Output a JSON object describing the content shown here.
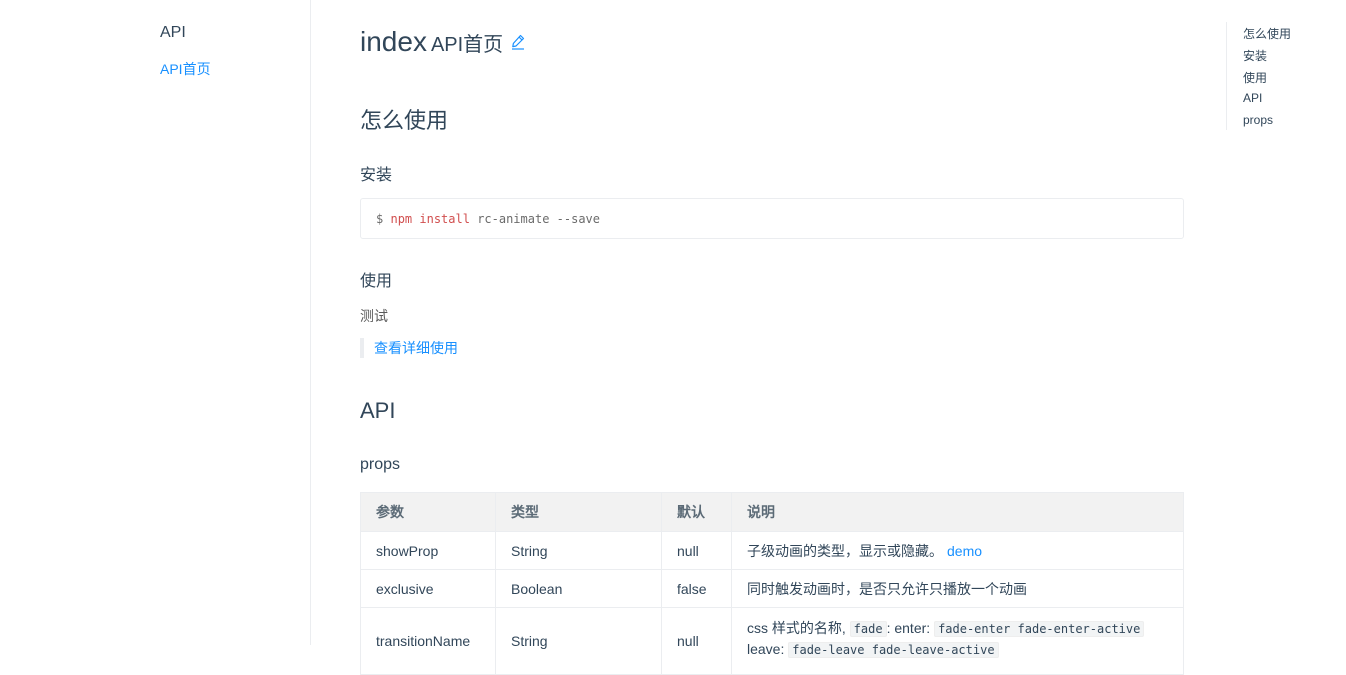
{
  "sidebar": {
    "title": "API",
    "items": [
      {
        "label": "API首页"
      }
    ]
  },
  "page": {
    "title_name": "index",
    "title_sub": "API首页",
    "edit_icon": "pencil-icon"
  },
  "content": {
    "h_usage": "怎么使用",
    "h_install": "安装",
    "install_code": {
      "prompt": "$",
      "cmd": "npm install",
      "args": "rc-animate --save"
    },
    "h_use": "使用",
    "test_text": "测试",
    "detail_link": "查看详细使用",
    "h_api": "API",
    "h_props": "props"
  },
  "table": {
    "headers": [
      "参数",
      "类型",
      "默认",
      "说明"
    ],
    "rows": [
      {
        "param": "showProp",
        "type": "String",
        "default": "null",
        "desc": "子级动画的类型，显示或隐藏。",
        "link": "demo"
      },
      {
        "param": "exclusive",
        "type": "Boolean",
        "default": "false",
        "desc": "同时触发动画时，是否只允许只播放一个动画"
      },
      {
        "param": "transitionName",
        "type": "String",
        "default": "null",
        "desc_prefix": "css 样式的名称,",
        "code1": "fade",
        "desc_mid": ": enter:",
        "code2": "fade-enter fade-enter-active",
        "desc_line2": "leave:",
        "code3": "fade-leave fade-leave-active"
      }
    ]
  },
  "toc": {
    "items": [
      {
        "label": "怎么使用"
      },
      {
        "label": "安装"
      },
      {
        "label": "使用"
      },
      {
        "label": "API"
      },
      {
        "label": "props"
      }
    ]
  },
  "colors": {
    "link": "#1890ff",
    "text": "#314659",
    "code_keyword": "#d14e4e"
  }
}
